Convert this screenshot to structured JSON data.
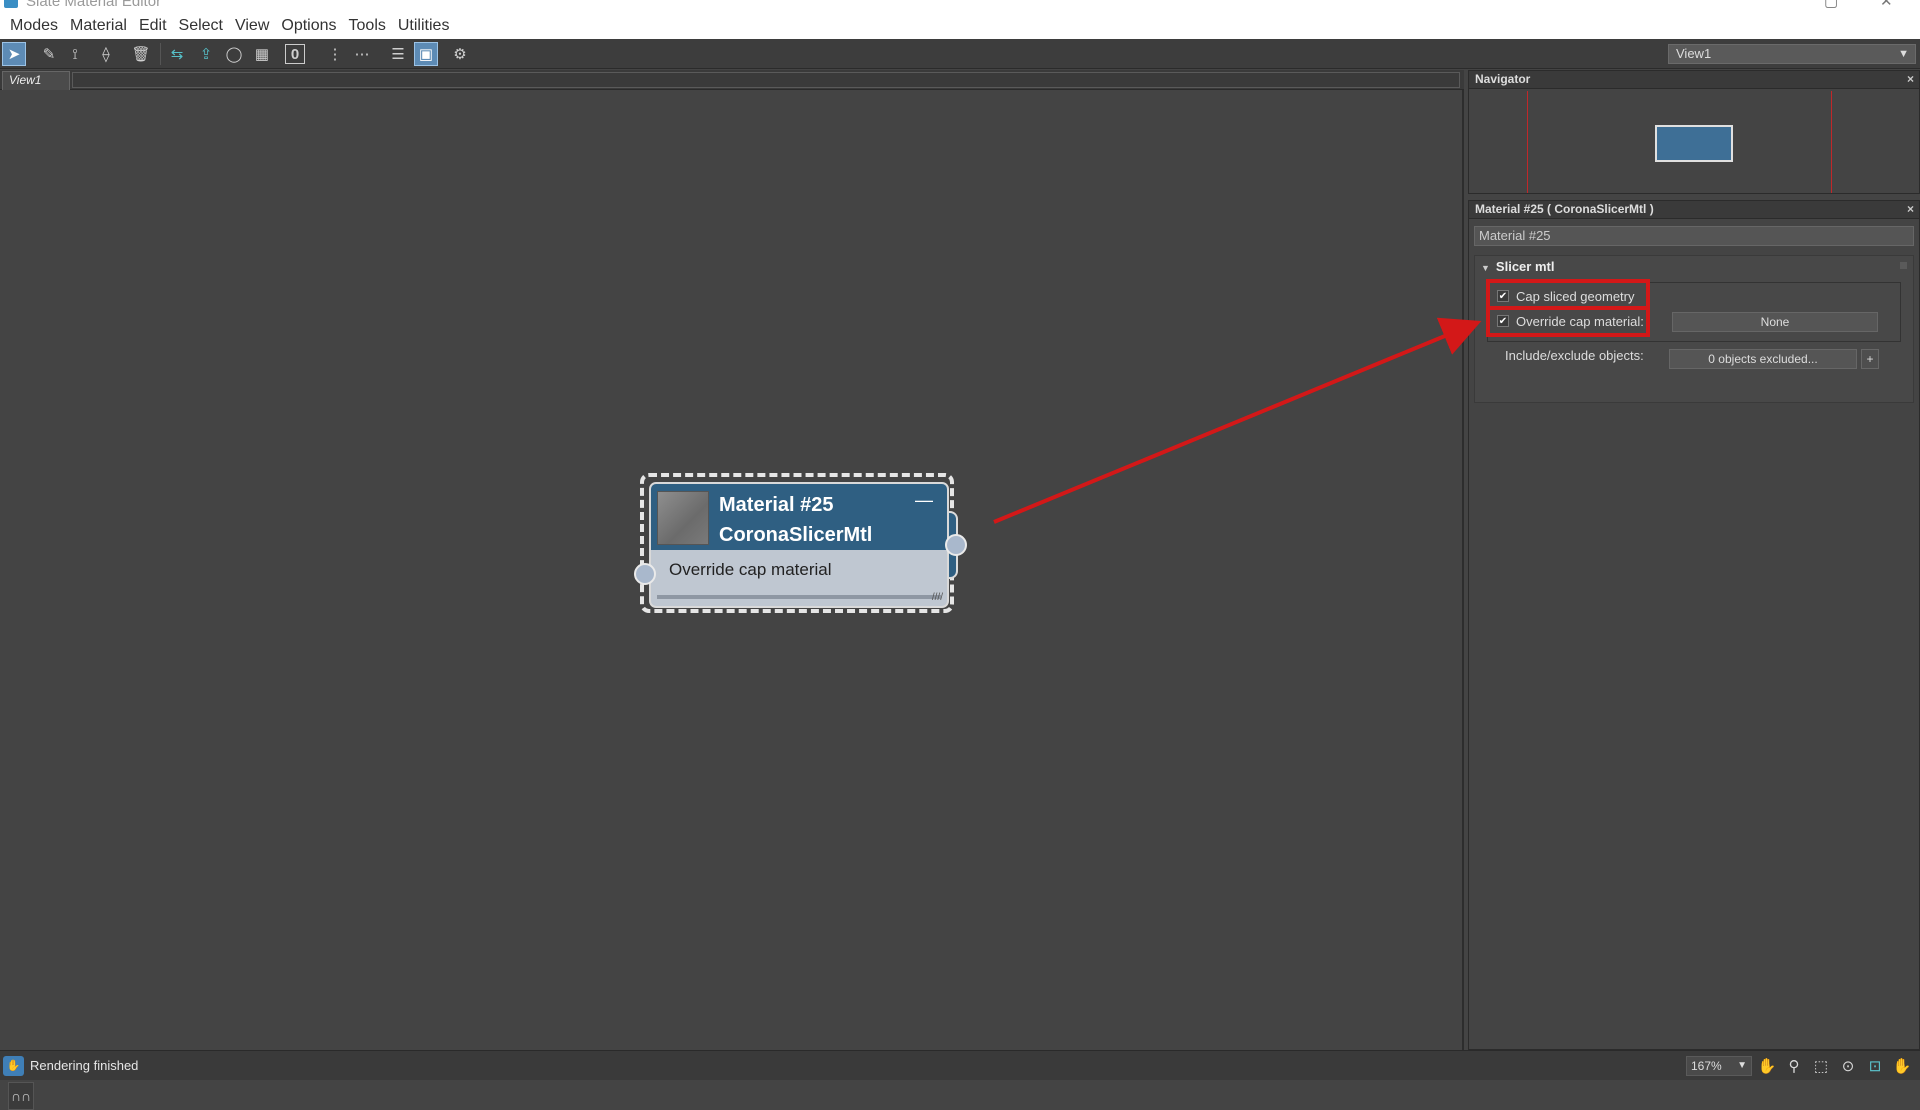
{
  "window": {
    "title": "Slate Material Editor"
  },
  "menu": [
    "Modes",
    "Material",
    "Edit",
    "Select",
    "View",
    "Options",
    "Tools",
    "Utilities"
  ],
  "toolbar": {
    "tools": [
      {
        "name": "select-tool",
        "icon": "cursor-icon",
        "glyph": "➤",
        "active": true
      },
      {
        "name": "pick-material-tool",
        "icon": "eyedropper-icon",
        "glyph": "✎"
      },
      {
        "name": "put-material-tool",
        "icon": "assign-icon",
        "glyph": "⟟"
      },
      {
        "name": "assign-selection-tool",
        "icon": "assign-selection-icon",
        "glyph": "⟠"
      },
      {
        "name": "delete-tool",
        "icon": "trash-icon",
        "glyph": "🗑"
      },
      {
        "name": "move-children-tool",
        "icon": "move-children-icon",
        "glyph": "⇆"
      },
      {
        "name": "select-by-material-tool",
        "icon": "select-by-material-icon",
        "glyph": "⇪"
      },
      {
        "name": "background-tool",
        "icon": "sphere-icon",
        "glyph": "◯"
      },
      {
        "name": "checker-tool",
        "icon": "checker-icon",
        "glyph": "▦"
      },
      {
        "name": "material-id-tool",
        "icon": "material-id-icon",
        "glyph": "0"
      },
      {
        "name": "layout-vertical-tool",
        "icon": "layout-vertical-icon",
        "glyph": "⋮"
      },
      {
        "name": "layout-horizontal-tool",
        "icon": "layout-horizontal-icon",
        "glyph": "⋯"
      },
      {
        "name": "hide-unused-slots-tool",
        "icon": "list-icon",
        "glyph": "☰"
      },
      {
        "name": "show-map-tool",
        "icon": "show-map-icon",
        "glyph": "▣",
        "active": true
      },
      {
        "name": "options-tool",
        "icon": "options-icon",
        "glyph": "⚙"
      }
    ]
  },
  "view_selector": {
    "value": "View1"
  },
  "view": {
    "tab_label": "View1",
    "node": {
      "name": "Material #25",
      "type": "CoronaSlicerMtl",
      "slot_label": "Override cap material"
    }
  },
  "navigator": {
    "title": "Navigator"
  },
  "properties": {
    "title": "Material #25  ( CoronaSlicerMtl )",
    "name_field": "Material #25",
    "rollout_title": "Slicer mtl",
    "cap_sliced_geometry": {
      "label": "Cap sliced geometry",
      "checked": true
    },
    "override_cap_material": {
      "label": "Override cap material:",
      "checked": true,
      "button": "None"
    },
    "include_exclude": {
      "label": "Include/exclude objects:",
      "button": "0 objects excluded...",
      "plus": "+"
    }
  },
  "status": {
    "text": "Rendering finished",
    "zoom": "167%"
  },
  "colors": {
    "annotation": "#d31818",
    "node_header": "#2f5f82",
    "accent": "#5d8bb5"
  }
}
